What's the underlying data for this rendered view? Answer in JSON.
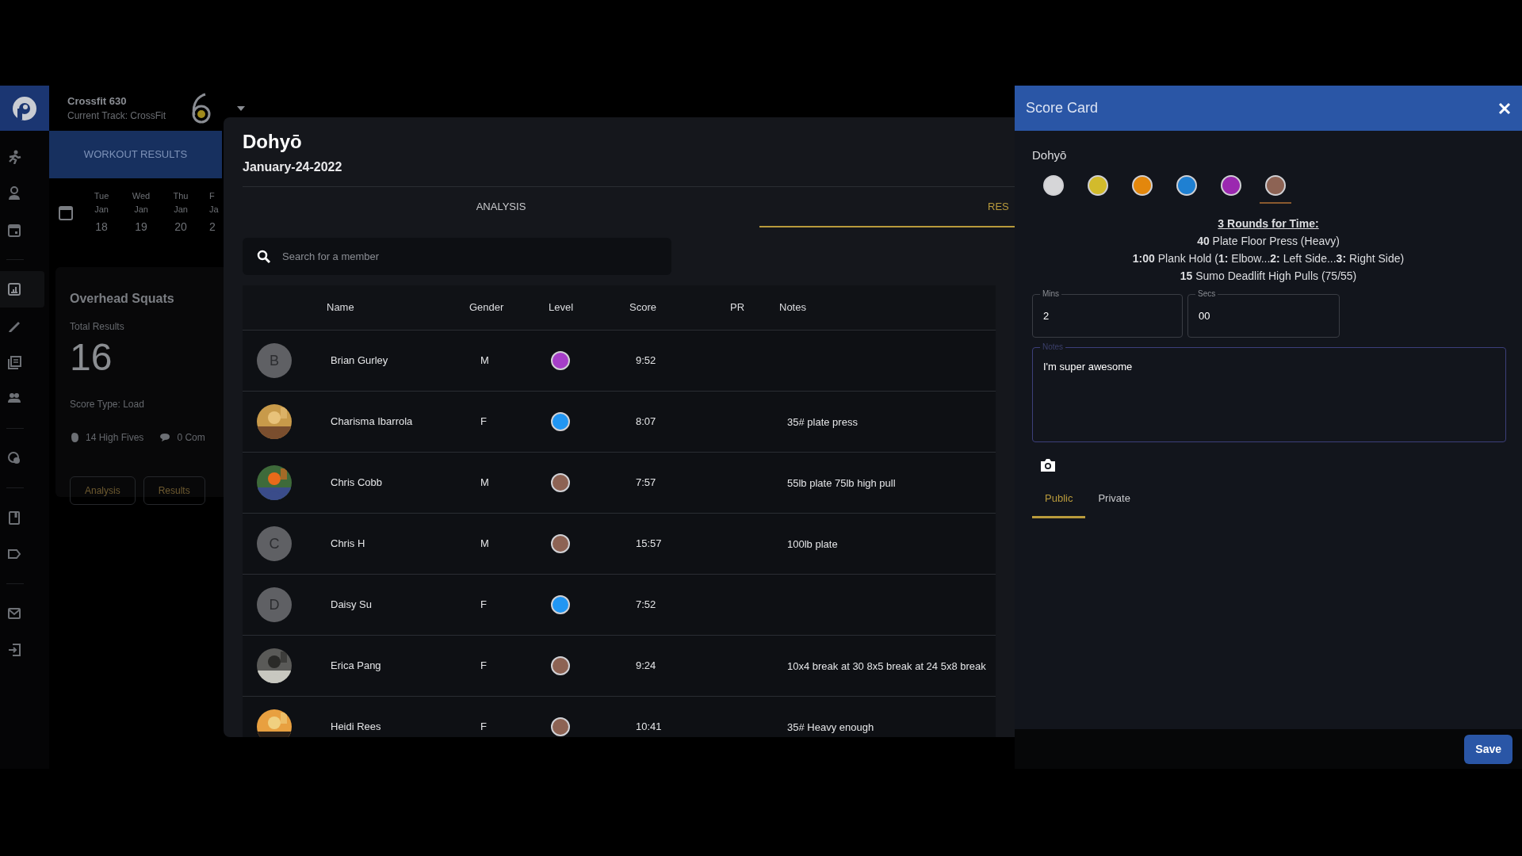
{
  "sidebar": {
    "groups": [
      {
        "items": [
          {
            "kind": "runner",
            "selected": false
          },
          {
            "kind": "person",
            "selected": false
          },
          {
            "kind": "calendar",
            "selected": false
          }
        ]
      },
      {
        "items": [
          {
            "kind": "report",
            "selected": true
          },
          {
            "kind": "pencil",
            "selected": false
          },
          {
            "kind": "copy",
            "selected": false
          },
          {
            "kind": "group",
            "selected": false
          }
        ]
      },
      {
        "items": [
          {
            "kind": "coins",
            "selected": false
          }
        ]
      },
      {
        "items": [
          {
            "kind": "book",
            "selected": false
          },
          {
            "kind": "tag",
            "selected": false
          }
        ]
      },
      {
        "items": [
          {
            "kind": "mail",
            "selected": false
          },
          {
            "kind": "login",
            "selected": false
          }
        ]
      }
    ]
  },
  "header": {
    "gym": "Crossfit 630",
    "track": "Current Track: CrossFit"
  },
  "left_panel": {
    "section": "WORKOUT RESULTS",
    "days": [
      {
        "weekday": "Tue",
        "month": "Jan",
        "day": "18"
      },
      {
        "weekday": "Wed",
        "month": "Jan",
        "day": "19"
      },
      {
        "weekday": "Thu",
        "month": "Jan",
        "day": "20"
      },
      {
        "weekday": "F",
        "month": "Ja",
        "day": "2"
      }
    ],
    "card": {
      "title": "Overhead Squats",
      "total_label": "Total Results",
      "total": "16",
      "score_type": "Score Type: Load",
      "high_fives": "14 High Fives",
      "comments": "0 Com",
      "buttons": [
        "Analysis",
        "Results"
      ]
    }
  },
  "results_panel": {
    "title": "Dohyō",
    "date": "January-24-2022",
    "tabs": [
      {
        "label": "ANALYSIS",
        "selected": false
      },
      {
        "label": "RES",
        "selected": true
      }
    ],
    "search": {
      "placeholder": "Search for a member"
    },
    "table": {
      "columns": [
        "Name",
        "Gender",
        "Level",
        "Score",
        "PR",
        "Notes"
      ],
      "rows": [
        {
          "avatar": {
            "kind": "initial",
            "initial": "B"
          },
          "name": "Brian Gurley",
          "gender": "M",
          "color": "#a63fc8",
          "score": "9:52"
        },
        {
          "name": "Charisma Ibarrola",
          "gender": "F",
          "color": "#2196f3",
          "score": "8:07",
          "notes": "35# plate press"
        },
        {
          "name": "Chris Cobb",
          "gender": "M",
          "color": "#8d6354",
          "score": "7:57",
          "notes": "55lb plate 75lb high pull"
        },
        {
          "avatar": {
            "kind": "initial",
            "initial": "C"
          },
          "name": "Chris H",
          "gender": "M",
          "color": "#8d6354",
          "score": "15:57",
          "notes": "100lb plate"
        },
        {
          "avatar": {
            "kind": "initial",
            "initial": "D"
          },
          "name": "Daisy Su",
          "gender": "F",
          "color": "#2196f3",
          "score": "7:52"
        },
        {
          "name": "Erica Pang",
          "gender": "F",
          "color": "#8d6354",
          "score": "9:24",
          "notes": "10x4 break at 30 8x5 break at 24 5x8 break"
        },
        {
          "name": "Heidi Rees",
          "gender": "F",
          "color": "#8d6354",
          "score": "10:41",
          "notes": "35# Heavy enough"
        }
      ]
    }
  },
  "score_card": {
    "title": "Score Card",
    "workout": "Dohyō",
    "levels": [
      {
        "color": "#d6d6d8",
        "selected": false
      },
      {
        "color": "#d2bb2c",
        "selected": false
      },
      {
        "color": "#e3870c",
        "selected": false
      },
      {
        "color": "#1f80d2",
        "selected": false
      },
      {
        "color": "#9b28b0",
        "selected": false
      },
      {
        "color": "#8d6354",
        "selected": true
      }
    ],
    "description": [
      "3 Rounds for Time:",
      "**40** Plate Floor Press (Heavy)",
      "**1:00** Plank Hold (**1:** Elbow...**2:** Left Side...**3:** Right Side)",
      "**15** Sumo Deadlift High Pulls (75/55)"
    ],
    "mins": {
      "label": "Mins",
      "value": "2"
    },
    "secs": {
      "label": "Secs",
      "value": "00"
    },
    "notes": {
      "label": "Notes",
      "value": "I'm super awesome"
    },
    "tabs": [
      {
        "label": "Public",
        "selected": true
      },
      {
        "label": "Private",
        "selected": false
      }
    ],
    "save": "Save"
  }
}
